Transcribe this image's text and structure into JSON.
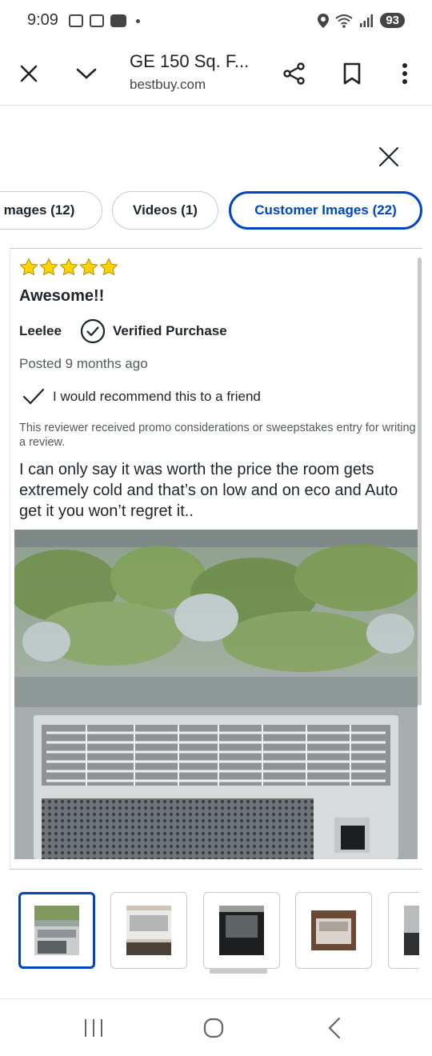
{
  "status_bar": {
    "time": "9:09",
    "battery": "93"
  },
  "browser": {
    "title": "GE 150 Sq. F...",
    "url": "bestbuy.com",
    "icons": [
      "close-icon",
      "chevron-down-icon",
      "share-icon",
      "bookmark-icon",
      "more-vert-icon"
    ]
  },
  "tabs": [
    {
      "label": "mages (12)"
    },
    {
      "label": "Videos (1)"
    },
    {
      "label": "Customer Images (22)",
      "active": true
    }
  ],
  "review": {
    "rating": 5,
    "title": "Awesome!!",
    "reviewer": "Leelee",
    "verified_label": "Verified Purchase",
    "posted": "Posted 9 months ago",
    "recommend": "I would recommend this to a friend",
    "disclaimer": "This reviewer received promo considerations or sweepstakes entry for writing a review.",
    "body": "I can only say it was worth the price the room gets extremely cold and that’s on low and on eco and Auto get it you won’t regret it.."
  },
  "thumbnails": {
    "count": 5,
    "selected_index": 0
  },
  "colors": {
    "accent": "#0046be",
    "star": "#ffd200",
    "text": "#1d252c"
  }
}
